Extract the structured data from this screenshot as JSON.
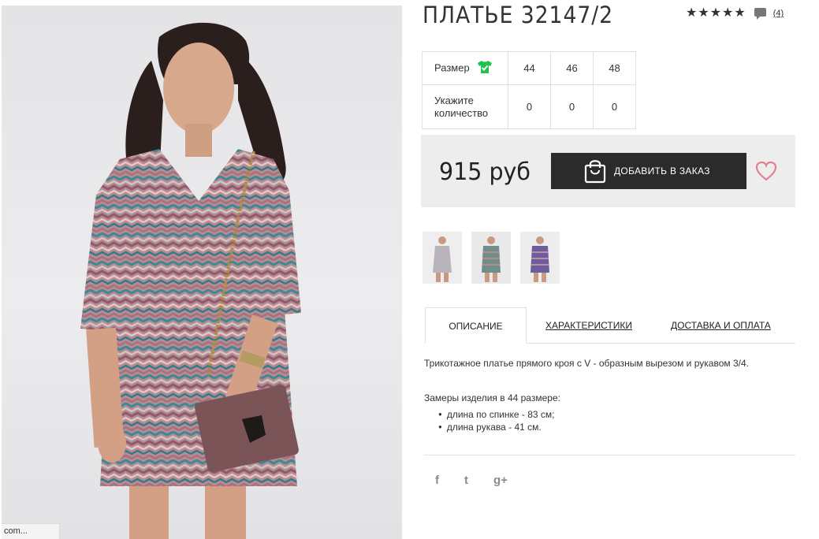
{
  "product": {
    "title": "ПЛАТЬЕ 32147/2",
    "rating": {
      "stars": 5,
      "review_count": "(4)"
    }
  },
  "sizes": {
    "row1_label": "Размер",
    "sizes": [
      "44",
      "46",
      "48"
    ],
    "row2_label_line1": "Укажите",
    "row2_label_line2": "количество",
    "quantities": [
      "0",
      "0",
      "0"
    ]
  },
  "purchase": {
    "price": "915 руб",
    "add_button": "ДОБАВИТЬ В ЗАКАЗ"
  },
  "tabs": {
    "description": "ОПИСАНИЕ",
    "characteristics": "ХАРАКТЕРИСТИКИ",
    "delivery": "ДОСТАВКА И ОПЛАТА"
  },
  "description": {
    "text": "Трикотажное платье прямого кроя с V - образным вырезом и рукавом 3/4.",
    "measures_title": "Замеры изделия в 44 размере:",
    "measures": [
      "длина по спинке - 83 см;",
      "длина рукава - 41 см."
    ]
  },
  "social": {
    "facebook": "f",
    "twitter": "t",
    "google": "g+"
  },
  "status_bar": "com...",
  "icons": {
    "rating": "star-icon",
    "comments": "comment-icon",
    "size_guide": "shirt-check-icon",
    "cart": "shopping-bag-icon",
    "wishlist": "heart-icon"
  },
  "colors": {
    "accent_green": "#1fc24a",
    "heart": "#e2808f",
    "button": "#2b2b2b"
  }
}
